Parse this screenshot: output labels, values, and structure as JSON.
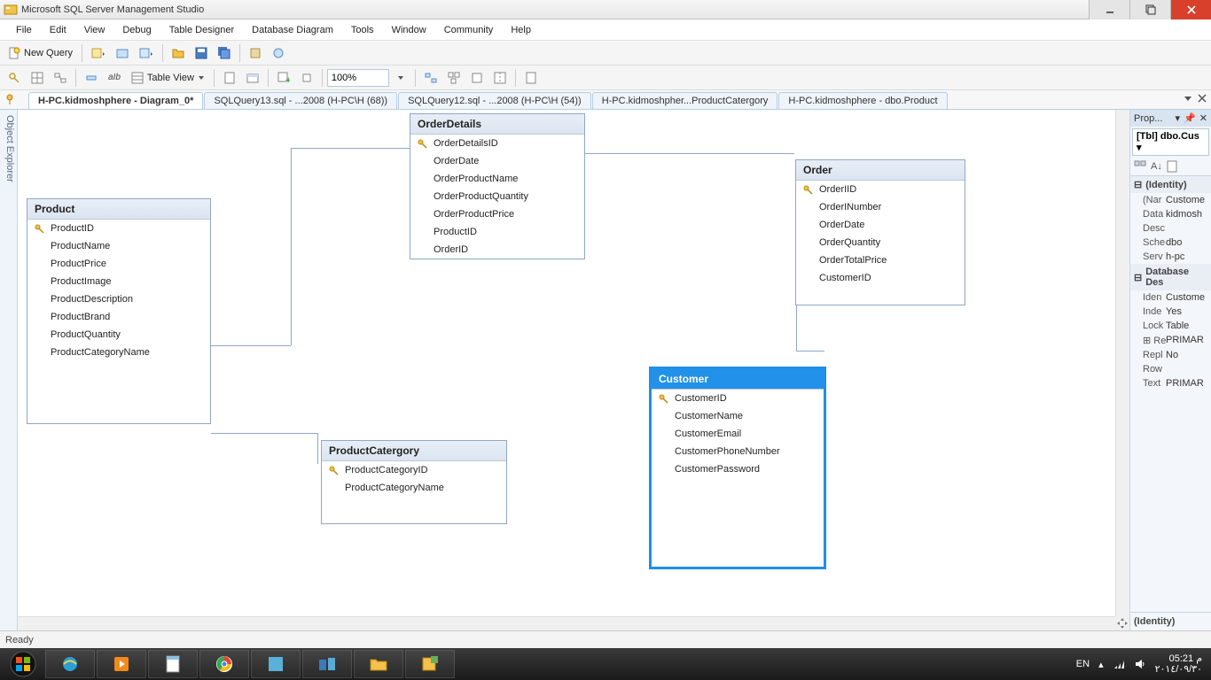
{
  "titlebar": {
    "title": "Microsoft SQL Server Management Studio"
  },
  "menus": [
    "File",
    "Edit",
    "View",
    "Debug",
    "Table Designer",
    "Database Diagram",
    "Tools",
    "Window",
    "Community",
    "Help"
  ],
  "toolbar1": {
    "new_query": "New Query"
  },
  "toolbar2": {
    "table_view": "Table View",
    "zoom": "100%"
  },
  "tabs": [
    {
      "label": "H-PC.kidmoshphere - Diagram_0*",
      "active": true
    },
    {
      "label": "SQLQuery13.sql - ...2008 (H-PC\\H (68))",
      "active": false
    },
    {
      "label": "SQLQuery12.sql - ...2008 (H-PC\\H (54))",
      "active": false
    },
    {
      "label": "H-PC.kidmoshpher...ProductCatergory",
      "active": false
    },
    {
      "label": "H-PC.kidmoshphere - dbo.Product",
      "active": false
    }
  ],
  "sidetab": "Object Explorer",
  "tables": {
    "product": {
      "title": "Product",
      "fields": [
        "ProductID",
        "ProductName",
        "ProductPrice",
        "ProductImage",
        "ProductDescription",
        "ProductBrand",
        "ProductQuantity",
        "ProductCategoryName"
      ],
      "pk": 0
    },
    "orderdetails": {
      "title": "OrderDetails",
      "fields": [
        "OrderDetailsID",
        "OrderDate",
        "OrderProductName",
        "OrderProductQuantity",
        "OrderProductPrice",
        "ProductID",
        "OrderID"
      ],
      "pk": 0
    },
    "order": {
      "title": "Order",
      "fields": [
        "OrderIID",
        "OrderINumber",
        "OrderDate",
        "OrderQuantity",
        "OrderTotalPrice",
        "CustomerID"
      ],
      "pk": 0
    },
    "customer": {
      "title": "Customer",
      "fields": [
        "CustomerID",
        "CustomerName",
        "CustomerEmail",
        "CustomerPhoneNumber",
        "CustomerPassword"
      ],
      "pk": 0
    },
    "productcategory": {
      "title": "ProductCatergory",
      "fields": [
        "ProductCategoryID",
        "ProductCategoryName"
      ],
      "pk": 0
    }
  },
  "props": {
    "title": "Prop...",
    "selected": "[Tbl] dbo.Cus",
    "cat1": "(Identity)",
    "rows1": [
      {
        "k": "(Nar",
        "v": "Custome"
      },
      {
        "k": "Data",
        "v": "kidmosh"
      },
      {
        "k": "Desc",
        "v": ""
      },
      {
        "k": "Sche",
        "v": "dbo"
      },
      {
        "k": "Serv",
        "v": "h-pc"
      }
    ],
    "cat2": "Database Des",
    "rows2": [
      {
        "k": "Iden",
        "v": "Custome"
      },
      {
        "k": "Inde",
        "v": "Yes"
      },
      {
        "k": "Lock",
        "v": "Table"
      },
      {
        "k": "Regu",
        "v": "PRIMAR"
      },
      {
        "k": "Repl",
        "v": "No"
      },
      {
        "k": "Row",
        "v": ""
      },
      {
        "k": "Text",
        "v": "PRIMAR"
      }
    ],
    "footer": "(Identity)"
  },
  "status": "Ready",
  "tray": {
    "lang": "EN",
    "time": "05:21 م",
    "date": "٢٠١٤/٠٩/٣٠"
  }
}
